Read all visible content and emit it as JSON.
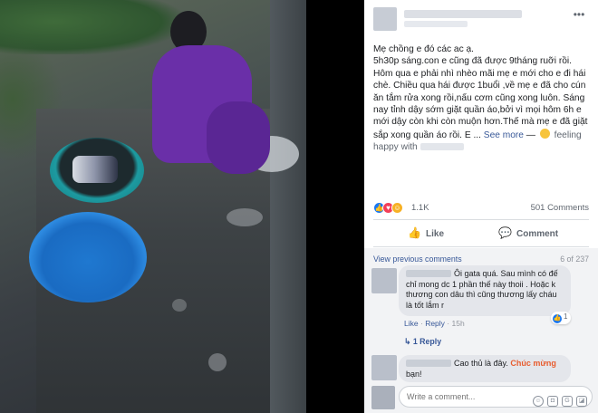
{
  "post": {
    "lines": [
      "Mẹ chồng e đó các ac ạ.",
      "5h30p sáng.con e cũng đã được 9tháng ruỡi rồi.",
      "Hôm qua e phải nhì nhèo mãi mẹ e mới cho e đi hái",
      "chè. Chiều qua hái được 1buổi ,về mẹ e đã cho cún",
      "ăn tắm rửa xong rồi,nấu cơm cũng xong luôn. Sáng",
      "nay tỉnh dậy sớm giặt quần áo,bởi vì mọi hôm 6h e",
      "mới dậy còn khi còn muộn hơn.Thế mà mẹ e đã giặt",
      "sắp xong quần áo rồi. E ..."
    ],
    "see_more": "See more",
    "dash": "—",
    "feeling": "feeling",
    "feeling_value": "happy with"
  },
  "reactions": {
    "count": "1.1K",
    "comments": "501 Comments",
    "icons": [
      "like-icon",
      "love-icon",
      "haha-icon"
    ],
    "colors": {
      "like": "#1877f2",
      "love": "#f33e58",
      "haha": "#f7b125"
    }
  },
  "actions": {
    "like": "Like",
    "comment": "Comment"
  },
  "comments": {
    "view_more": "View previous comments",
    "page_count": "6 of 237",
    "items": [
      {
        "text_lines": [
          "Ôi gata quá. Sau mình có đế",
          "chỉ mong dc 1 phần thế này thoii . Hoặc k",
          "thương con dâu thì cũng thương lấy cháu",
          "là tốt lắm r"
        ],
        "like": "Like",
        "reply": "Reply",
        "time": "15h",
        "react_count": "1",
        "replies_link": "1 Reply"
      },
      {
        "text_before": "Cao thủ là đây.",
        "highlight": "Chúc mừng",
        "text_after": "bạn!"
      }
    ]
  },
  "composer": {
    "placeholder": "Write a comment..."
  }
}
